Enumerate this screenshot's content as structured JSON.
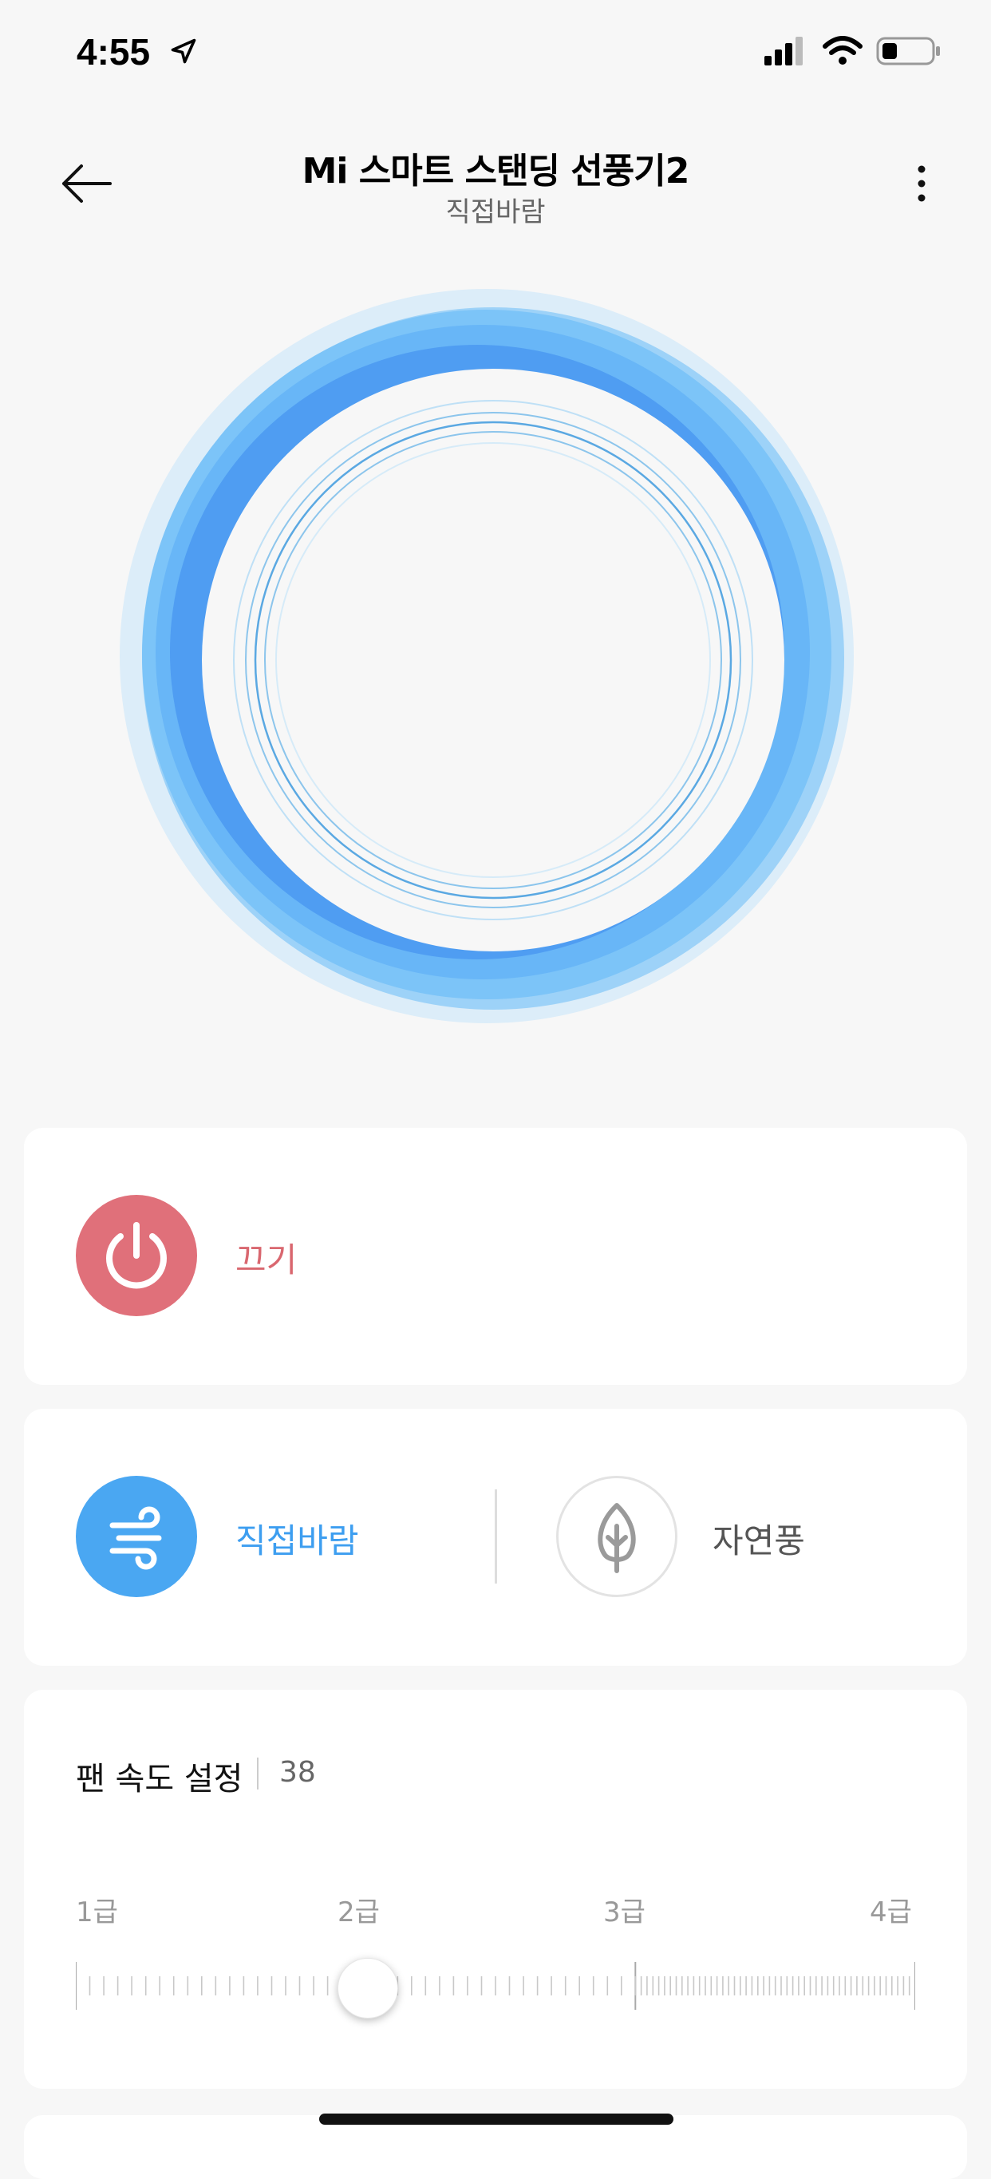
{
  "status_bar": {
    "time": "4:55"
  },
  "header": {
    "title": "Mi 스마트 스탠딩 선풍기2",
    "subtitle": "직접바람"
  },
  "power": {
    "label": "끄기",
    "color": "#e0707a"
  },
  "modes": [
    {
      "label": "직접바람",
      "active": true,
      "color": "#4aa7f2"
    },
    {
      "label": "자연풍",
      "active": false
    }
  ],
  "speed": {
    "title": "팬 속도 설정",
    "value": "38",
    "levels": [
      "1급",
      "2급",
      "3급",
      "4급"
    ],
    "fraction": 0.38
  },
  "icons": {
    "back": "arrow-left-icon",
    "more": "more-vertical-icon",
    "power": "power-icon",
    "wind": "wind-icon",
    "leaf": "leaf-icon"
  }
}
